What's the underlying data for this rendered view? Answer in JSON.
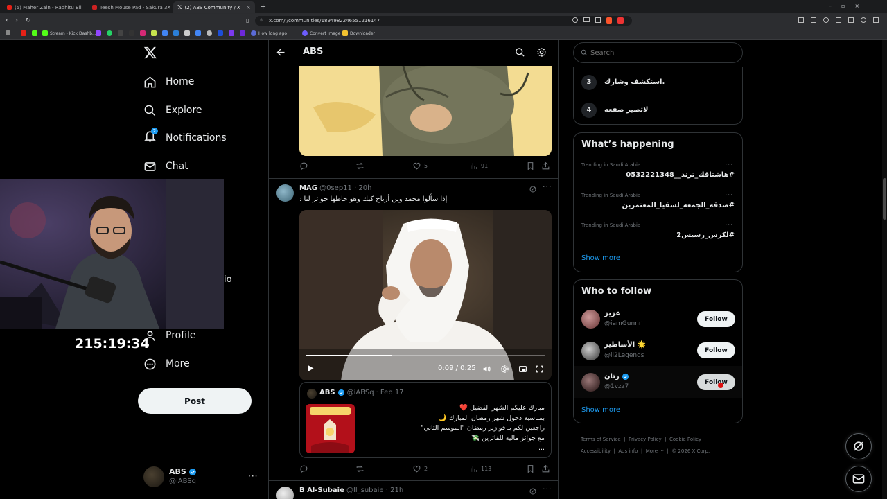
{
  "browser": {
    "tabs": [
      {
        "label": "(5) Maher Zain - Radhitu Billahi Rabba",
        "active": false
      },
      {
        "label": "Teesh Mouse Pad - Sakura 3XL - Teesh",
        "active": false
      },
      {
        "label": "(2) ABS Community / X",
        "active": true
      }
    ],
    "url": "x.com/i/communities/1894982246551216147",
    "bookmarks": [
      "Stream - Kick Dashb...",
      "How long ago",
      "Convert Image",
      "Downloader"
    ]
  },
  "nav": {
    "items": [
      {
        "label": "Home",
        "icon": "home-icon"
      },
      {
        "label": "Explore",
        "icon": "search-icon"
      },
      {
        "label": "Notifications",
        "icon": "bell-icon",
        "badge": "2"
      },
      {
        "label": "Chat",
        "icon": "mail-icon"
      },
      {
        "label": "Profile",
        "icon": "person-icon"
      },
      {
        "label": "More",
        "icon": "more-circle-icon"
      }
    ],
    "hidden_fragment": "io",
    "post_label": "Post",
    "account": {
      "name": "ABS",
      "handle": "@iABSq"
    }
  },
  "stream_timer": "215:19:34",
  "header": {
    "title": "ABS"
  },
  "tweet1": {
    "likes": "5",
    "views": "91"
  },
  "tweet2": {
    "name": "MAG",
    "handle": "@0sep11",
    "time": "· 20h",
    "text": "إذا سألوا محمد وين أرباح كيك وهو حاطها جوائز لنا :",
    "video_time": "0:09 / 0:25",
    "video_progress": 0.36,
    "quote": {
      "name": "ABS",
      "handle": "@iABSq",
      "date": "· Feb 17",
      "lines": [
        "مبارك عليكم الشهر الفضيل ❤️",
        "بمناسبة دخول شهر رمضان المبارك 🌙",
        "راجعين لكم بـ فوازير رمضان \"الموسم الثاني\"",
        "مع جوائز مالية للفائزين 💸"
      ],
      "more": "..."
    },
    "likes": "2",
    "views": "113"
  },
  "tweet3": {
    "name": "B Al-Subaie",
    "handle": "@ll_subaie",
    "time": "· 21h"
  },
  "search": {
    "placeholder": "Search"
  },
  "community_rules": [
    {
      "num": "3",
      "text": ".استكشف وشارك"
    },
    {
      "num": "4",
      "text": "لاتصير ضفعه"
    }
  ],
  "whats_happening": {
    "title": "What’s happening",
    "trends": [
      {
        "context": "Trending in Saudi Arabia",
        "text": "#هاشتاقك_ترند__0532221348"
      },
      {
        "context": "Trending in Saudi Arabia",
        "text": "#صدقه_الجمعه_لسقيا_المعتمرين"
      },
      {
        "context": "Trending in Saudi Arabia",
        "text": "#لكزس_رسيس2"
      }
    ],
    "show_more": "Show more"
  },
  "who_to_follow": {
    "title": "Who to follow",
    "users": [
      {
        "name": "عزيز",
        "handle": "@iamGunnr",
        "verified": false,
        "follow": "Follow"
      },
      {
        "name": "الأساطير 🌟",
        "handle": "@li2Legends",
        "verified": false,
        "follow": "Follow"
      },
      {
        "name": "رتان",
        "handle": "@1vzz7",
        "verified": true,
        "follow": "Follow"
      }
    ],
    "show_more": "Show more"
  },
  "footer": {
    "links": [
      "Terms of Service",
      "Privacy Policy",
      "Cookie Policy",
      "Accessibility",
      "Ads info",
      "More ···",
      "© 2026 X Corp."
    ]
  },
  "colors": {
    "accent": "#1d9bf0",
    "verified": "#1d9bf0",
    "like_red": "#f91880",
    "bg": "#000000",
    "border": "#2f3336"
  }
}
